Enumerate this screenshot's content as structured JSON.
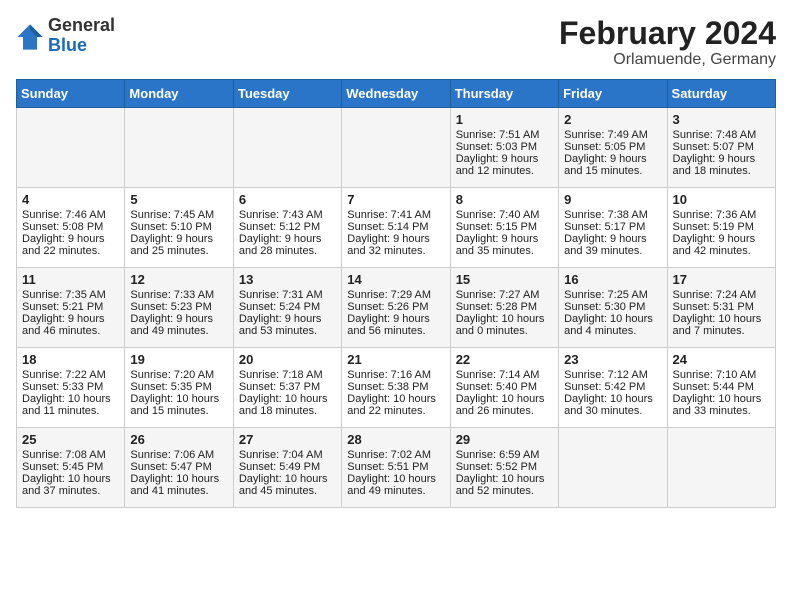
{
  "logo": {
    "general": "General",
    "blue": "Blue"
  },
  "title": "February 2024",
  "subtitle": "Orlamuende, Germany",
  "days": [
    "Sunday",
    "Monday",
    "Tuesday",
    "Wednesday",
    "Thursday",
    "Friday",
    "Saturday"
  ],
  "weeks": [
    [
      {
        "day": "",
        "content": ""
      },
      {
        "day": "",
        "content": ""
      },
      {
        "day": "",
        "content": ""
      },
      {
        "day": "",
        "content": ""
      },
      {
        "day": "1",
        "content": "Sunrise: 7:51 AM\nSunset: 5:03 PM\nDaylight: 9 hours\nand 12 minutes."
      },
      {
        "day": "2",
        "content": "Sunrise: 7:49 AM\nSunset: 5:05 PM\nDaylight: 9 hours\nand 15 minutes."
      },
      {
        "day": "3",
        "content": "Sunrise: 7:48 AM\nSunset: 5:07 PM\nDaylight: 9 hours\nand 18 minutes."
      }
    ],
    [
      {
        "day": "4",
        "content": "Sunrise: 7:46 AM\nSunset: 5:08 PM\nDaylight: 9 hours\nand 22 minutes."
      },
      {
        "day": "5",
        "content": "Sunrise: 7:45 AM\nSunset: 5:10 PM\nDaylight: 9 hours\nand 25 minutes."
      },
      {
        "day": "6",
        "content": "Sunrise: 7:43 AM\nSunset: 5:12 PM\nDaylight: 9 hours\nand 28 minutes."
      },
      {
        "day": "7",
        "content": "Sunrise: 7:41 AM\nSunset: 5:14 PM\nDaylight: 9 hours\nand 32 minutes."
      },
      {
        "day": "8",
        "content": "Sunrise: 7:40 AM\nSunset: 5:15 PM\nDaylight: 9 hours\nand 35 minutes."
      },
      {
        "day": "9",
        "content": "Sunrise: 7:38 AM\nSunset: 5:17 PM\nDaylight: 9 hours\nand 39 minutes."
      },
      {
        "day": "10",
        "content": "Sunrise: 7:36 AM\nSunset: 5:19 PM\nDaylight: 9 hours\nand 42 minutes."
      }
    ],
    [
      {
        "day": "11",
        "content": "Sunrise: 7:35 AM\nSunset: 5:21 PM\nDaylight: 9 hours\nand 46 minutes."
      },
      {
        "day": "12",
        "content": "Sunrise: 7:33 AM\nSunset: 5:23 PM\nDaylight: 9 hours\nand 49 minutes."
      },
      {
        "day": "13",
        "content": "Sunrise: 7:31 AM\nSunset: 5:24 PM\nDaylight: 9 hours\nand 53 minutes."
      },
      {
        "day": "14",
        "content": "Sunrise: 7:29 AM\nSunset: 5:26 PM\nDaylight: 9 hours\nand 56 minutes."
      },
      {
        "day": "15",
        "content": "Sunrise: 7:27 AM\nSunset: 5:28 PM\nDaylight: 10 hours\nand 0 minutes."
      },
      {
        "day": "16",
        "content": "Sunrise: 7:25 AM\nSunset: 5:30 PM\nDaylight: 10 hours\nand 4 minutes."
      },
      {
        "day": "17",
        "content": "Sunrise: 7:24 AM\nSunset: 5:31 PM\nDaylight: 10 hours\nand 7 minutes."
      }
    ],
    [
      {
        "day": "18",
        "content": "Sunrise: 7:22 AM\nSunset: 5:33 PM\nDaylight: 10 hours\nand 11 minutes."
      },
      {
        "day": "19",
        "content": "Sunrise: 7:20 AM\nSunset: 5:35 PM\nDaylight: 10 hours\nand 15 minutes."
      },
      {
        "day": "20",
        "content": "Sunrise: 7:18 AM\nSunset: 5:37 PM\nDaylight: 10 hours\nand 18 minutes."
      },
      {
        "day": "21",
        "content": "Sunrise: 7:16 AM\nSunset: 5:38 PM\nDaylight: 10 hours\nand 22 minutes."
      },
      {
        "day": "22",
        "content": "Sunrise: 7:14 AM\nSunset: 5:40 PM\nDaylight: 10 hours\nand 26 minutes."
      },
      {
        "day": "23",
        "content": "Sunrise: 7:12 AM\nSunset: 5:42 PM\nDaylight: 10 hours\nand 30 minutes."
      },
      {
        "day": "24",
        "content": "Sunrise: 7:10 AM\nSunset: 5:44 PM\nDaylight: 10 hours\nand 33 minutes."
      }
    ],
    [
      {
        "day": "25",
        "content": "Sunrise: 7:08 AM\nSunset: 5:45 PM\nDaylight: 10 hours\nand 37 minutes."
      },
      {
        "day": "26",
        "content": "Sunrise: 7:06 AM\nSunset: 5:47 PM\nDaylight: 10 hours\nand 41 minutes."
      },
      {
        "day": "27",
        "content": "Sunrise: 7:04 AM\nSunset: 5:49 PM\nDaylight: 10 hours\nand 45 minutes."
      },
      {
        "day": "28",
        "content": "Sunrise: 7:02 AM\nSunset: 5:51 PM\nDaylight: 10 hours\nand 49 minutes."
      },
      {
        "day": "29",
        "content": "Sunrise: 6:59 AM\nSunset: 5:52 PM\nDaylight: 10 hours\nand 52 minutes."
      },
      {
        "day": "",
        "content": ""
      },
      {
        "day": "",
        "content": ""
      }
    ]
  ]
}
